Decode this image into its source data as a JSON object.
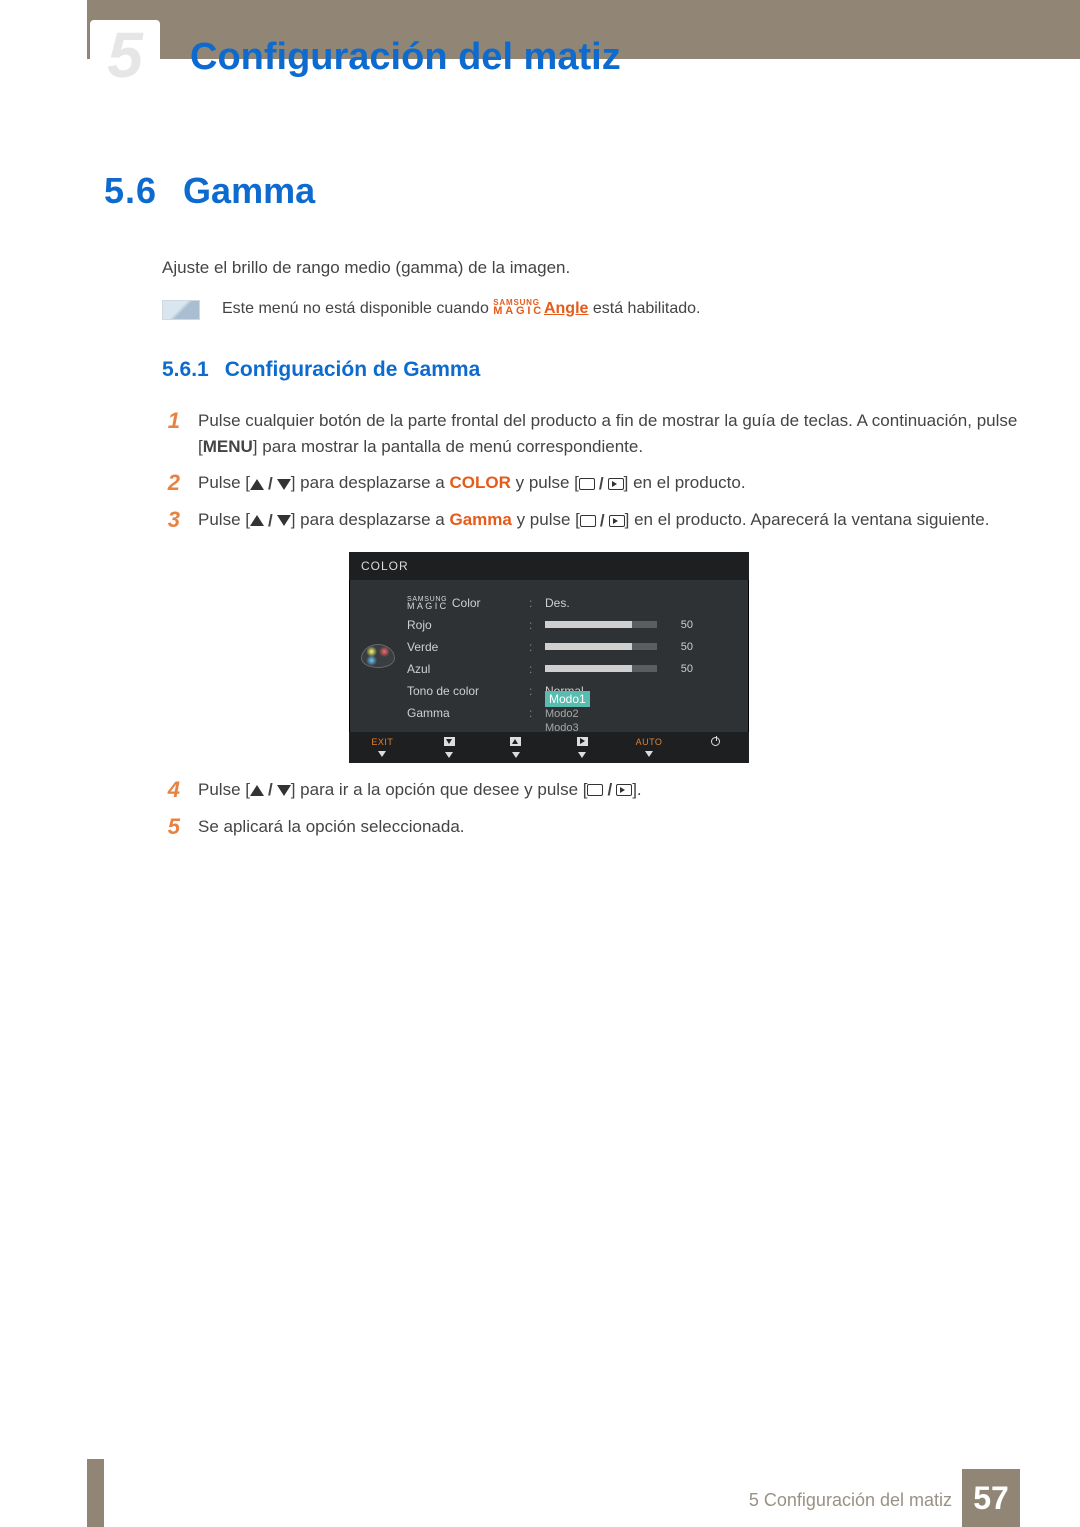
{
  "chapter_number": "5",
  "chapter_title": "Configuración del matiz",
  "section": {
    "num": "5.6",
    "title": "Gamma"
  },
  "intro": "Ajuste el brillo de rango medio (gamma) de la imagen.",
  "note": {
    "pre": "Este menú no está disponible cuando ",
    "magic_top": "SAMSUNG",
    "magic_bot": "MAGIC",
    "angle": "Angle",
    "post": " está habilitado."
  },
  "subsection": {
    "num": "5.6.1",
    "title": "Configuración de Gamma"
  },
  "steps": {
    "s1a": "Pulse cualquier botón de la parte frontal del producto a fin de mostrar la guía de teclas. A continuación, pulse [",
    "s1menu": "MENU",
    "s1b": "] para mostrar la pantalla de menú correspondiente.",
    "s2a": "Pulse [",
    "s2b": "] para desplazarse a ",
    "s2c": "COLOR",
    "s2d": " y pulse [",
    "s2e": "] en el producto.",
    "s3a": "Pulse [",
    "s3b": "] para desplazarse a ",
    "s3c": "Gamma",
    "s3d": " y pulse [",
    "s3e": "] en el producto. Aparecerá la ventana siguiente.",
    "s4a": "Pulse [",
    "s4b": "] para ir a la opción que desee y pulse [",
    "s4c": "].",
    "s5": "Se aplicará la opción seleccionada."
  },
  "osd": {
    "title": "COLOR",
    "magic_top": "SAMSUNG",
    "magic_bot": "MAGIC",
    "magic_color": " Color",
    "magic_val": "Des.",
    "rojo": "Rojo",
    "rojo_v": "50",
    "verde": "Verde",
    "verde_v": "50",
    "azul": "Azul",
    "azul_v": "50",
    "tono": "Tono de color",
    "tono_v": "Normal",
    "gamma": "Gamma",
    "modo1": "Modo1",
    "modo2": "Modo2",
    "modo3": "Modo3",
    "foot_exit": "EXIT",
    "foot_auto": "AUTO"
  },
  "footer": {
    "text": "5 Configuración del matiz",
    "page": "57"
  }
}
